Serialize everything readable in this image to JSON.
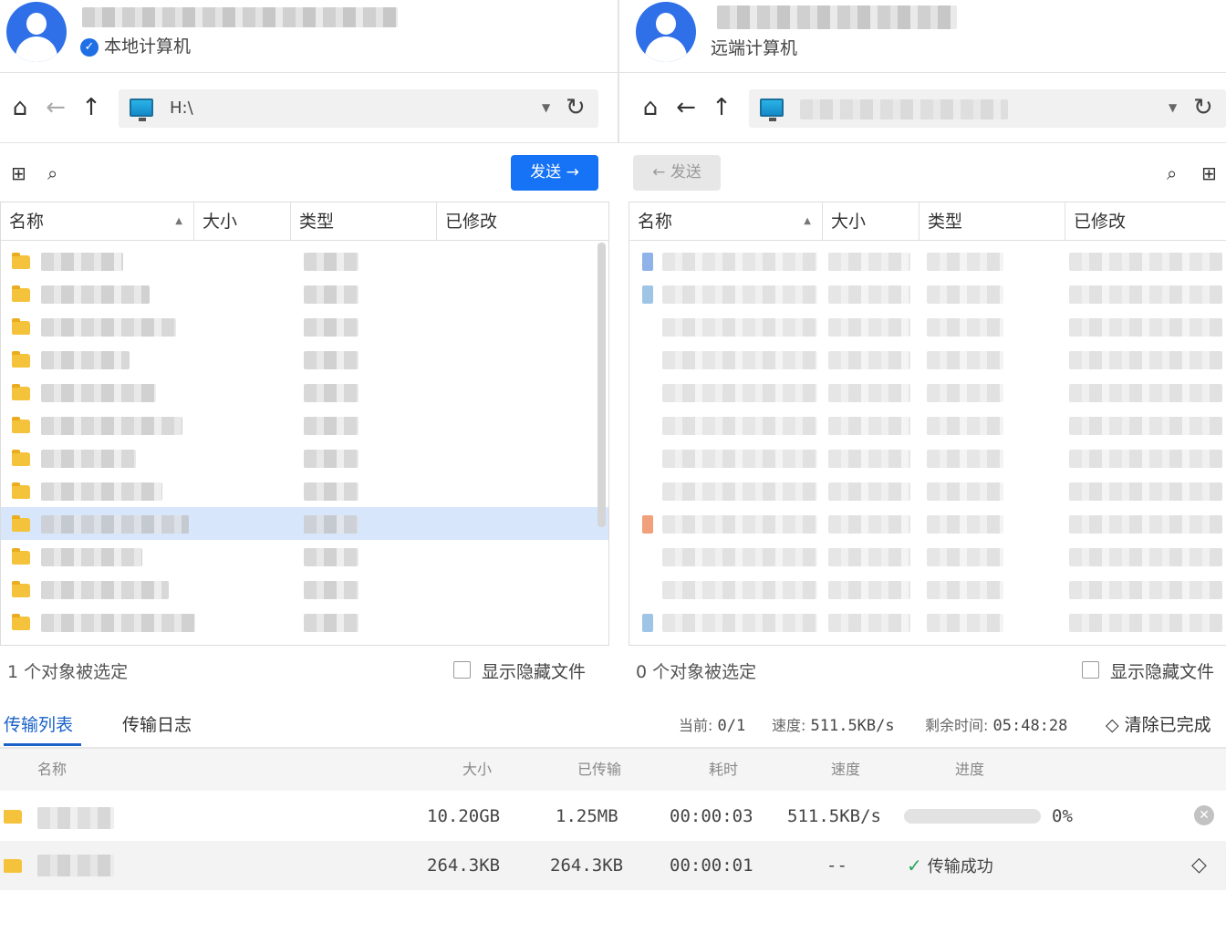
{
  "local": {
    "label": "本地计算机",
    "path": "H:\\",
    "send_label": "发送",
    "columns": [
      "名称",
      "大小",
      "类型",
      "已修改"
    ],
    "row_count": 12,
    "selected_row": 8,
    "selection_status": "1 个对象被选定",
    "show_hidden_label": "显示隐藏文件"
  },
  "remote": {
    "label": "远端计算机",
    "send_label": "发送",
    "columns": [
      "名称",
      "大小",
      "类型",
      "已修改"
    ],
    "row_count": 12,
    "selection_status": "0 个对象被选定",
    "show_hidden_label": "显示隐藏文件"
  },
  "transfer": {
    "tabs": [
      "传输列表",
      "传输日志"
    ],
    "active_tab": 0,
    "stats": {
      "current_label": "当前:",
      "current": "0/1",
      "speed_label": "速度:",
      "speed": "511.5KB/s",
      "remaining_label": "剩余时间:",
      "remaining": "05:48:28"
    },
    "clear_done_label": "清除已完成",
    "columns": [
      "名称",
      "大小",
      "已传输",
      "耗时",
      "速度",
      "进度"
    ],
    "rows": [
      {
        "size": "10.20GB",
        "transferred": "1.25MB",
        "elapsed": "00:00:03",
        "speed": "511.5KB/s",
        "progress": 0,
        "progress_text": "0%"
      },
      {
        "size": "264.3KB",
        "transferred": "264.3KB",
        "elapsed": "00:00:01",
        "speed": "--",
        "status": "传输成功"
      }
    ]
  },
  "colors": {
    "accent": "#1773f5",
    "selected_row": "#d8e6fb",
    "success": "#26a65b",
    "folder": "#f5c33b"
  }
}
